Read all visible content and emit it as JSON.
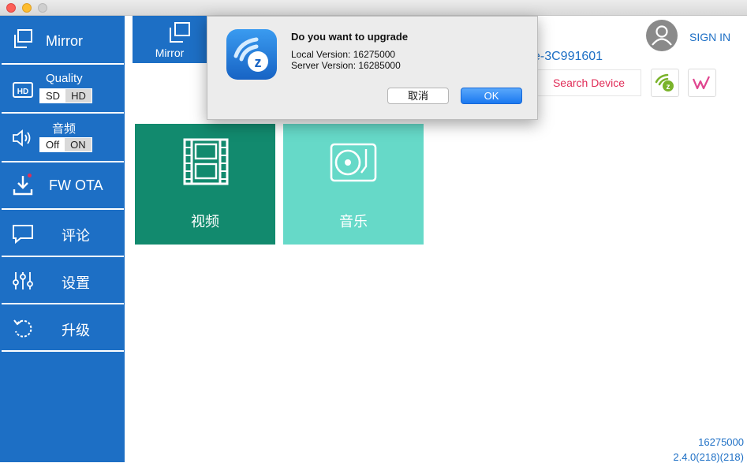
{
  "sidebar": {
    "mirror": {
      "label": "Mirror"
    },
    "quality": {
      "label": "Quality",
      "options": [
        "SD",
        "HD"
      ],
      "selected": "SD"
    },
    "audio": {
      "label": "音频",
      "options": [
        "Off",
        "ON"
      ],
      "selected": "Off"
    },
    "fw_ota": {
      "label": "FW OTA"
    },
    "comment": {
      "label": "评论"
    },
    "settings": {
      "label": "设置"
    },
    "upgrade": {
      "label": "升级"
    }
  },
  "main": {
    "mirror_tab_label": "Mirror",
    "device_name": "e-3C991601",
    "sign_in_label": "SIGN IN",
    "search_device_label": "Search Device",
    "tiles": [
      {
        "label": "视频",
        "icon": "film-icon",
        "color": "#128a6e"
      },
      {
        "label": "音乐",
        "icon": "turntable-icon",
        "color": "#66d9c8"
      }
    ]
  },
  "footer": {
    "build": "16275000",
    "version": "2.4.0(218)(218)"
  },
  "dialog": {
    "title": "Do you want to upgrade",
    "local_version": "Local Version: 16275000",
    "server_version": "Server Version: 16285000",
    "cancel_label": "取消",
    "ok_label": "OK"
  },
  "colors": {
    "accent": "#1d6fc5",
    "search_text": "#e02d58",
    "tile_video": "#128a6e",
    "tile_music": "#66d9c8"
  }
}
